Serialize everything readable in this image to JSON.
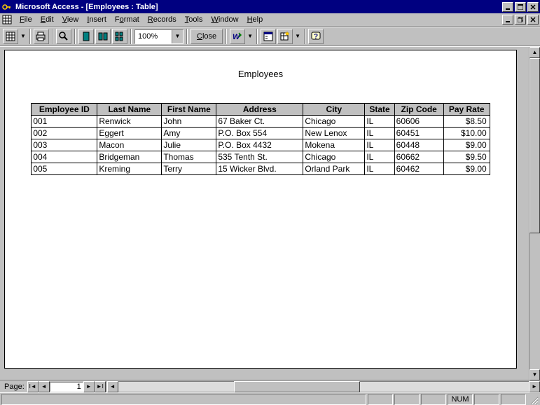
{
  "title": "Microsoft Access - [Employees : Table]",
  "menus": {
    "file": "File",
    "edit": "Edit",
    "view": "View",
    "insert": "Insert",
    "format": "Format",
    "records": "Records",
    "tools": "Tools",
    "window": "Window",
    "help": "Help"
  },
  "toolbar": {
    "zoom": "100%",
    "close": "Close"
  },
  "report": {
    "title": "Employees",
    "columns": [
      "Employee ID",
      "Last Name",
      "First Name",
      "Address",
      "City",
      "State",
      "Zip Code",
      "Pay Rate"
    ],
    "widths": [
      94,
      92,
      78,
      124,
      88,
      42,
      70,
      66
    ],
    "rows": [
      [
        "001",
        "Renwick",
        "John",
        "67 Baker Ct.",
        "Chicago",
        "IL",
        "60606",
        "$8.50"
      ],
      [
        "002",
        "Eggert",
        "Amy",
        "P.O. Box 554",
        "New Lenox",
        "IL",
        "60451",
        "$10.00"
      ],
      [
        "003",
        "Macon",
        "Julie",
        "P.O. Box 4432",
        "Mokena",
        "IL",
        "60448",
        "$9.00"
      ],
      [
        "004",
        "Bridgeman",
        "Thomas",
        "535 Tenth St.",
        "Chicago",
        "IL",
        "60662",
        "$9.50"
      ],
      [
        "005",
        "Kreming",
        "Terry",
        "15 Wicker Blvd.",
        "Orland Park",
        "IL",
        "60462",
        "$9.00"
      ]
    ]
  },
  "paging": {
    "label": "Page:",
    "current": "1"
  },
  "status": {
    "num": "NUM"
  }
}
